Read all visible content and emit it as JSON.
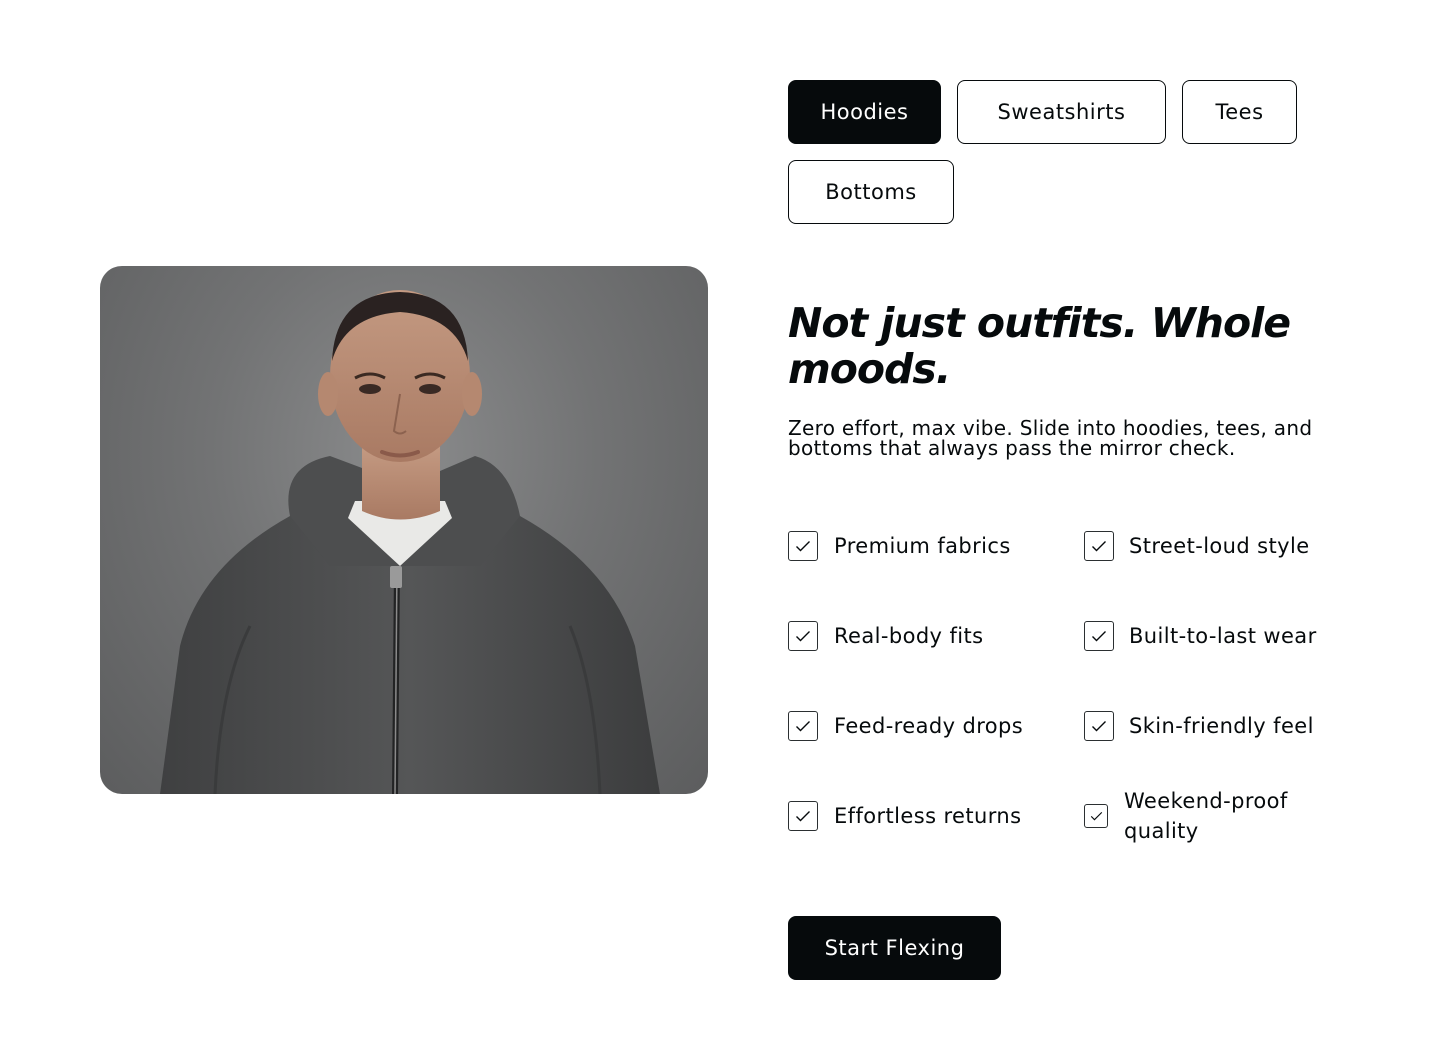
{
  "tabs": [
    {
      "label": "Hoodies",
      "active": true
    },
    {
      "label": "Sweatshirts",
      "active": false
    },
    {
      "label": "Tees",
      "active": false
    },
    {
      "label": "Bottoms",
      "active": false
    }
  ],
  "headline": "Not just outfits. Whole moods.",
  "description": "Zero effort, max vibe. Slide into hoodies, tees, and bottoms that always pass the mirror check.",
  "features": [
    {
      "label": "Premium fabrics",
      "checked": true,
      "icon": "check-icon"
    },
    {
      "label": "Street-loud style",
      "checked": true,
      "icon": "check-icon"
    },
    {
      "label": "Real-body fits",
      "checked": true,
      "icon": "check-icon"
    },
    {
      "label": "Built-to-last wear",
      "checked": true,
      "icon": "check-icon"
    },
    {
      "label": "Feed-ready drops",
      "checked": true,
      "icon": "check-icon"
    },
    {
      "label": "Skin-friendly feel",
      "checked": true,
      "icon": "check-icon"
    },
    {
      "label": "Effortless returns",
      "checked": true,
      "icon": "check-icon"
    },
    {
      "label": "Weekend-proof quality",
      "checked": true,
      "icon": "check-icon"
    }
  ],
  "cta": {
    "label": "Start Flexing"
  },
  "colors": {
    "ink": "#060a0c",
    "background": "#ffffff",
    "photo_backdrop": "#727374",
    "hoodie": "#4a4b4c"
  }
}
